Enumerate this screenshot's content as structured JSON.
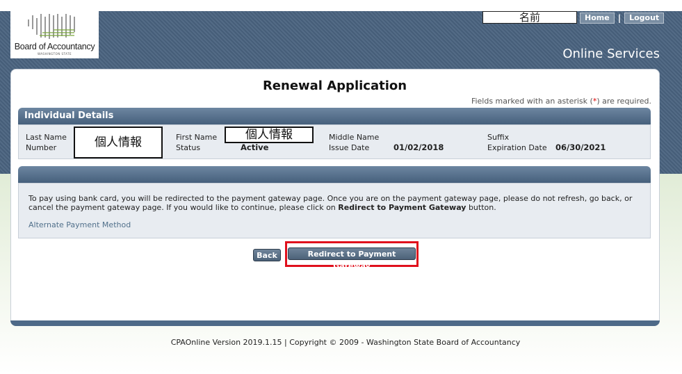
{
  "logo": {
    "org_name": "Board of Accountancy",
    "org_sub": "WASHINGTON STATE"
  },
  "header": {
    "user_name": "名前",
    "home_label": "Home",
    "separator": "|",
    "logout_label": "Logout",
    "site_title": "Online Services"
  },
  "page": {
    "title": "Renewal Application",
    "required_note_prefix": "Fields marked with an asterisk (",
    "required_note_asterisk": "*",
    "required_note_suffix": ") are required."
  },
  "details": {
    "section_title": "Individual Details",
    "last_name_label": "Last Name",
    "last_name_value": "個人情報",
    "number_label": "Number",
    "first_name_label": "First Name",
    "first_name_value": "個人情報",
    "status_label": "Status",
    "status_value": "Active",
    "middle_name_label": "Middle Name",
    "issue_date_label": "Issue Date",
    "issue_date_value": "01/02/2018",
    "suffix_label": "Suffix",
    "expiration_date_label": "Expiration Date",
    "expiration_date_value": "06/30/2021"
  },
  "payment": {
    "message_part1": "To pay using bank card, you will be redirected to the payment gateway page. Once you are on the payment gateway page, please do not refresh, go back, or cancel the payment gateway page. If you would like to continue, please click on ",
    "message_bold": "Redirect to Payment Gateway",
    "message_part2": " button.",
    "alternate_link": "Alternate Payment Method"
  },
  "buttons": {
    "back": "Back",
    "redirect": "Redirect to Payment Gateway"
  },
  "footer": {
    "text": "CPAOnline Version 2019.1.15 | Copyright © 2009 - Washington State Board of Accountancy"
  },
  "colors": {
    "header_bg": "#4a637f",
    "highlight": "#e0101c",
    "asterisk": "#d00000"
  }
}
